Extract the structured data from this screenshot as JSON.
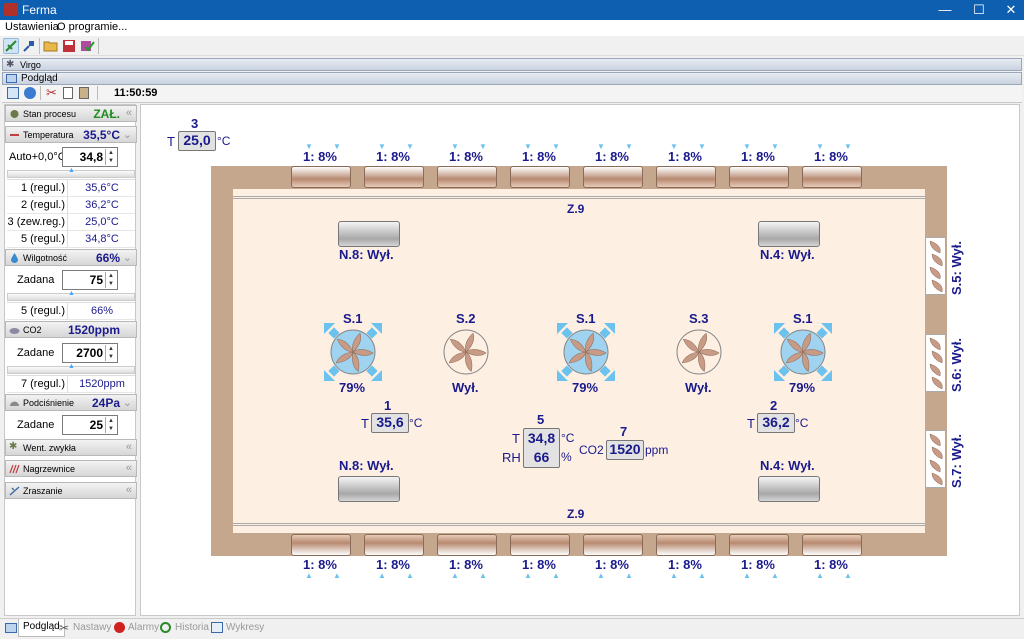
{
  "window": {
    "title": "Ferma"
  },
  "menu": {
    "items": [
      "Ustawienia",
      "O programie..."
    ]
  },
  "panels": {
    "virgo": "Virgo",
    "podglad": "Podgląd"
  },
  "clock": "11:50:59",
  "sidebar": {
    "process": {
      "label": "Stan procesu",
      "value": "ZAŁ."
    },
    "temperature": {
      "label": "Temperatura",
      "value": "35,5°C",
      "auto_label": "Auto+0,0°C",
      "auto_value": "34,8",
      "rows": [
        {
          "k": "1 (regul.)",
          "v": "35,6°C"
        },
        {
          "k": "2 (regul.)",
          "v": "36,2°C"
        },
        {
          "k": "3 (zew.reg.)",
          "v": "25,0°C"
        },
        {
          "k": "5 (regul.)",
          "v": "34,8°C"
        }
      ]
    },
    "humidity": {
      "label": "Wilgotność",
      "value": "66%",
      "set_label": "Zadana",
      "set_value": "75",
      "rows": [
        {
          "k": "5 (regul.)",
          "v": "66%"
        }
      ]
    },
    "co2": {
      "label": "CO2",
      "value": "1520ppm",
      "set_label": "Zadane",
      "set_value": "2700",
      "rows": [
        {
          "k": "7 (regul.)",
          "v": "1520ppm"
        }
      ]
    },
    "pressure": {
      "label": "Podciśnienie",
      "value": "24Pa",
      "set_label": "Zadane",
      "set_value": "25"
    },
    "collapsed": [
      "Went. zwykła",
      "Nagrzewnice",
      "Zraszanie"
    ]
  },
  "bottom_tabs": [
    "Podgląd",
    "Nastawy",
    "Alarmy",
    "Historia",
    "Wykresy"
  ],
  "farm": {
    "outside": {
      "num": "3",
      "t_label": "T",
      "t_value": "25,0",
      "t_unit": "°C"
    },
    "inlet_label": "1: 8%",
    "zone_label": "Z.9",
    "heaters": {
      "top_left": "N.8: Wył.",
      "top_right": "N.4: Wył.",
      "bottom_left": "N.8: Wył.",
      "bottom_right": "N.4: Wył."
    },
    "fans": [
      {
        "name": "S.1",
        "status": "79%"
      },
      {
        "name": "S.2",
        "status": "Wył."
      },
      {
        "name": "S.1",
        "status": "79%"
      },
      {
        "name": "S.3",
        "status": "Wył."
      },
      {
        "name": "S.1",
        "status": "79%"
      }
    ],
    "side_fans": [
      "S.5: Wył.",
      "S.6: Wył.",
      "S.7: Wył."
    ],
    "sensors": {
      "s1": {
        "num": "1",
        "t_label": "T",
        "t_value": "35,6",
        "unit": "°C"
      },
      "s2": {
        "num": "2",
        "t_label": "T",
        "t_value": "36,2",
        "unit": "°C"
      },
      "s5": {
        "num": "5",
        "t_label": "T",
        "t_value": "34,8",
        "t_unit": "°C",
        "rh_label": "RH",
        "rh_value": "66",
        "rh_unit": "%"
      },
      "s7": {
        "num": "7",
        "label": "CO2",
        "value": "1520",
        "unit": "ppm"
      }
    }
  },
  "colors": {
    "titlebar": "#0e5fb0",
    "navy": "#1a1a8c",
    "wall": "#c5a78d",
    "floor": "#fdf0e3",
    "fan_blade": "#c89b86",
    "fan_active": "#9fd3f0",
    "green": "#1e8b1e"
  }
}
